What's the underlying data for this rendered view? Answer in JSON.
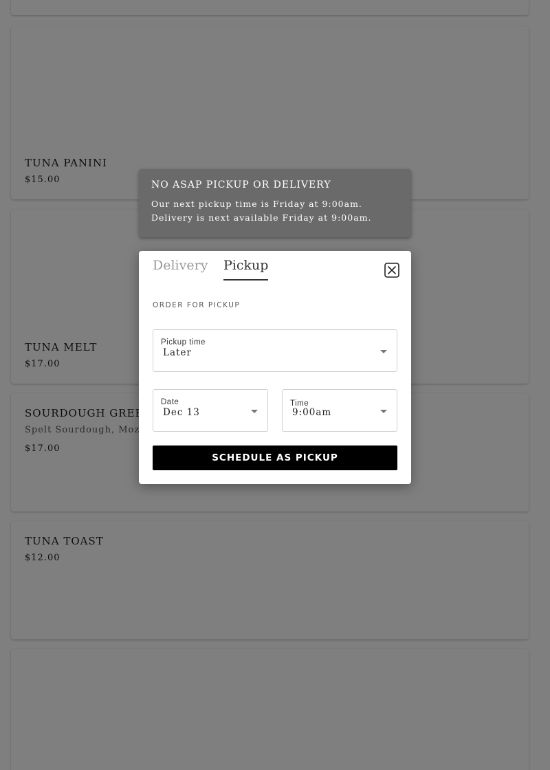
{
  "menu": {
    "items": [
      {
        "name": "TUNA PANINI",
        "price": "$15.00"
      },
      {
        "name": "TUNA MELT",
        "price": "$17.00"
      },
      {
        "name": "SOURDOUGH GREEK",
        "desc": "Spelt Sourdough, Mozz",
        "price": "$17.00"
      },
      {
        "name": "TUNA TOAST",
        "price": "$12.00"
      }
    ]
  },
  "toast": {
    "title": "NO ASAP PICKUP OR DELIVERY",
    "line1": "Our next pickup time is Friday at 9:00am.",
    "line2": "Delivery is next available Friday at 9:00am."
  },
  "modal": {
    "tabs": [
      {
        "label": "Delivery",
        "active": false
      },
      {
        "label": "Pickup",
        "active": true
      }
    ],
    "close_icon": "close-icon",
    "section_label": "ORDER FOR PICKUP",
    "pickup_time": {
      "label": "Pickup time",
      "value": "Later"
    },
    "date": {
      "label": "Date",
      "value": "Dec 13"
    },
    "time": {
      "label": "Time",
      "value": "9:00am"
    },
    "cta_label": "SCHEDULE AS PICKUP"
  },
  "colors": {
    "overlay": "#000000",
    "cta_background": "#000000",
    "toast_background": "#6a6a6a"
  }
}
